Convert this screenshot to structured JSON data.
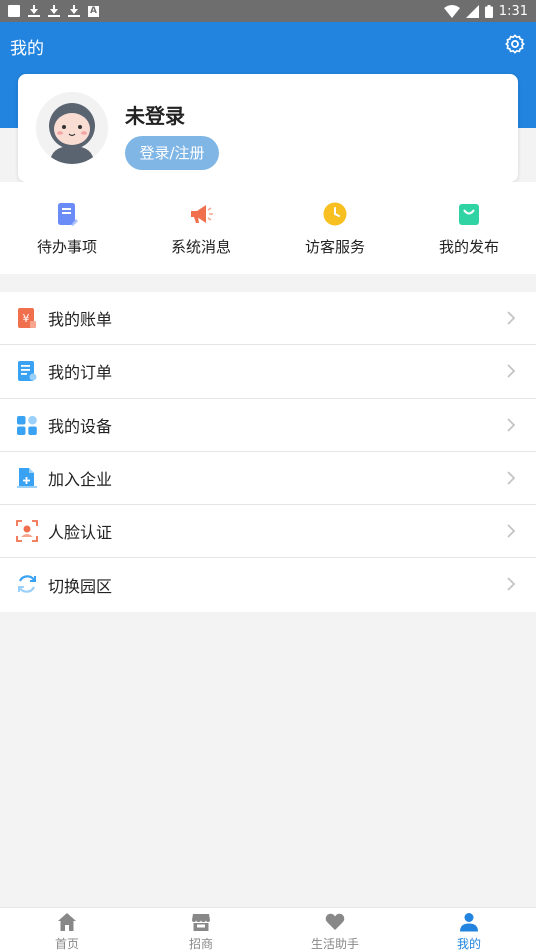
{
  "status_bar": {
    "time": "1:31"
  },
  "header": {
    "title": "我的",
    "settings_icon": "gear-icon"
  },
  "profile": {
    "name": "未登录",
    "login_button": "登录/注册",
    "avatar_icon": "astronaut-avatar-icon"
  },
  "quick_actions": [
    {
      "label": "待办事项",
      "icon": "document-pen-icon",
      "color": "#6b8cf6"
    },
    {
      "label": "系统消息",
      "icon": "megaphone-icon",
      "color": "#f0704e"
    },
    {
      "label": "访客服务",
      "icon": "clock-icon",
      "color": "#f7c020"
    },
    {
      "label": "我的发布",
      "icon": "shopping-bag-icon",
      "color": "#2fd3a4"
    }
  ],
  "menu": [
    {
      "label": "我的账单",
      "icon": "bill-yen-icon"
    },
    {
      "label": "我的订单",
      "icon": "order-list-icon"
    },
    {
      "label": "我的设备",
      "icon": "devices-grid-icon"
    },
    {
      "label": "加入企业",
      "icon": "join-enterprise-icon"
    },
    {
      "label": "人脸认证",
      "icon": "face-scan-icon"
    },
    {
      "label": "切换园区",
      "icon": "refresh-icon"
    }
  ],
  "tabbar": [
    {
      "label": "首页",
      "icon": "home-icon"
    },
    {
      "label": "招商",
      "icon": "storefront-icon"
    },
    {
      "label": "生活助手",
      "icon": "heart-icon"
    },
    {
      "label": "我的",
      "icon": "person-icon",
      "active": true
    }
  ],
  "colors": {
    "primary": "#2284de",
    "login_button": "#7fb6e6"
  }
}
